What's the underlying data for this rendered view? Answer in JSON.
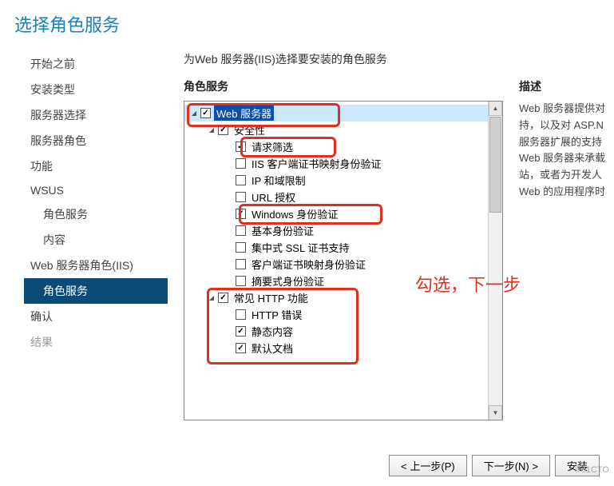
{
  "header": {
    "title": "选择角色服务"
  },
  "sidebar": {
    "items": [
      {
        "label": "开始之前"
      },
      {
        "label": "安装类型"
      },
      {
        "label": "服务器选择"
      },
      {
        "label": "服务器角色"
      },
      {
        "label": "功能"
      },
      {
        "label": "WSUS"
      },
      {
        "label": "角色服务",
        "sub": true
      },
      {
        "label": "内容",
        "sub": true
      },
      {
        "label": "Web 服务器角色(IIS)"
      },
      {
        "label": "角色服务",
        "sub": true,
        "active": true
      },
      {
        "label": "确认"
      },
      {
        "label": "结果",
        "dim": true
      }
    ]
  },
  "main": {
    "prompt": "为Web 服务器(IIS)选择要安装的角色服务",
    "roles_label": "角色服务",
    "desc_label": "描述",
    "desc_text": "Web 服务器提供对\n持，以及对 ASP.N\n服务器扩展的支持\nWeb 服务器来承载\n站，或者为开发人\nWeb 的应用程序时"
  },
  "tree": {
    "nodes": [
      {
        "indent": 0,
        "expander": "⊿",
        "checked": true,
        "label": "Web 服务器",
        "selected": true,
        "hl": true
      },
      {
        "indent": 1,
        "expander": "⊿",
        "checked": true,
        "label": "安全性"
      },
      {
        "indent": 2,
        "expander": "",
        "checked": true,
        "label": "请求筛选"
      },
      {
        "indent": 2,
        "expander": "",
        "checked": false,
        "label": "IIS 客户端证书映射身份验证"
      },
      {
        "indent": 2,
        "expander": "",
        "checked": false,
        "label": "IP 和域限制"
      },
      {
        "indent": 2,
        "expander": "",
        "checked": false,
        "label": "URL 授权"
      },
      {
        "indent": 2,
        "expander": "",
        "checked": true,
        "label": "Windows 身份验证"
      },
      {
        "indent": 2,
        "expander": "",
        "checked": false,
        "label": "基本身份验证"
      },
      {
        "indent": 2,
        "expander": "",
        "checked": false,
        "label": "集中式 SSL 证书支持"
      },
      {
        "indent": 2,
        "expander": "",
        "checked": false,
        "label": "客户端证书映射身份验证"
      },
      {
        "indent": 2,
        "expander": "",
        "checked": false,
        "label": "摘要式身份验证"
      },
      {
        "indent": 1,
        "expander": "⊿",
        "checked": true,
        "label": "常见 HTTP 功能"
      },
      {
        "indent": 2,
        "expander": "",
        "checked": false,
        "label": "HTTP 错误"
      },
      {
        "indent": 2,
        "expander": "",
        "checked": true,
        "label": "静态内容"
      },
      {
        "indent": 2,
        "expander": "",
        "checked": true,
        "label": "默认文档"
      }
    ]
  },
  "annotation": {
    "text": "勾选，下一步"
  },
  "footer": {
    "prev": "< 上一步(P)",
    "next": "下一步(N) >",
    "install": "安装"
  },
  "highlight_color": "#e03020"
}
